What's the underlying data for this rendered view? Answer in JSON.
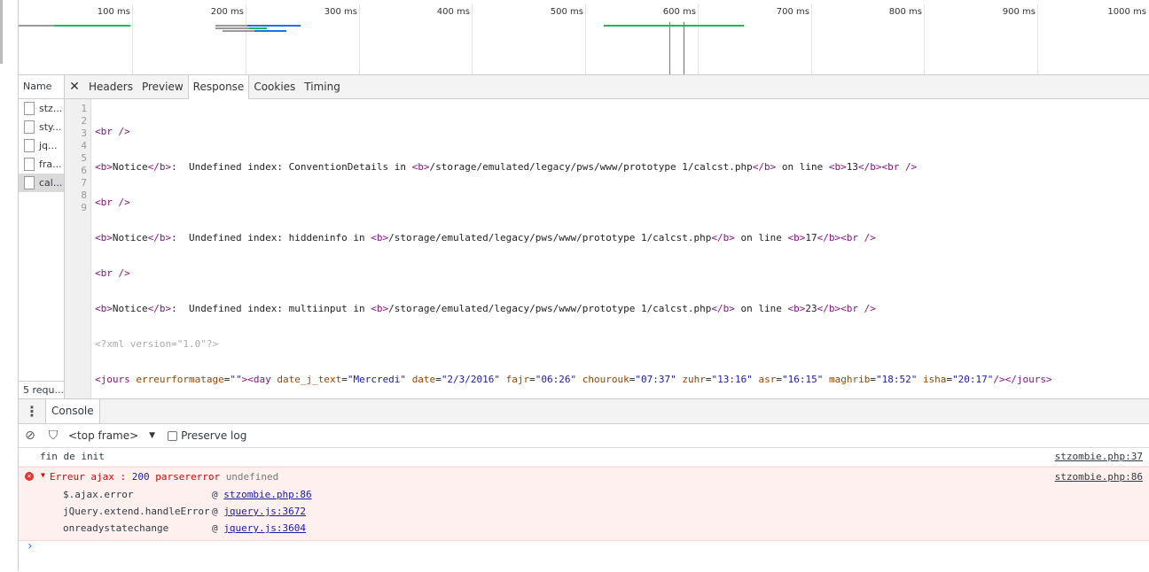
{
  "timeline": {
    "ticks": [
      "100 ms",
      "200 ms",
      "300 ms",
      "400 ms",
      "500 ms",
      "600 ms",
      "700 ms",
      "800 ms",
      "900 ms",
      "1000 ms"
    ]
  },
  "requests": {
    "header": "Name",
    "items": [
      {
        "label": "stz..."
      },
      {
        "label": "sty..."
      },
      {
        "label": "jq..."
      },
      {
        "label": "fra..."
      },
      {
        "label": "cal..."
      }
    ],
    "count": "5 requ..."
  },
  "detail": {
    "tabs": [
      "Headers",
      "Preview",
      "Response",
      "Cookies",
      "Timing"
    ],
    "active_tab": "Response",
    "line_numbers": [
      "1",
      "2",
      "3",
      "4",
      "5",
      "6",
      "7",
      "8",
      "9"
    ],
    "response_lines": [
      "<br />",
      "<b>Notice</b>:  Undefined index: ConventionDetails in <b>/storage/emulated/legacy/pws/www/prototype 1/calcst.php</b> on line <b>13</b><br />",
      "<br />",
      "<b>Notice</b>:  Undefined index: hiddeninfo in <b>/storage/emulated/legacy/pws/www/prototype 1/calcst.php</b> on line <b>17</b><br />",
      "<br />",
      "<b>Notice</b>:  Undefined index: multiinput in <b>/storage/emulated/legacy/pws/www/prototype 1/calcst.php</b> on line <b>23</b><br />",
      "<?xml version=\"1.0\"?>",
      "<jours erreurformatage=\"\"><day date_j_text=\"Mercredi\" date=\"2/3/2016\" fajr=\"06:26\" chourouk=\"07:37\" zuhr=\"13:16\" asr=\"16:15\" maghrib=\"18:52\" isha=\"20:17\"/></jours>",
      ""
    ]
  },
  "console": {
    "tab": "Console",
    "frame": "<top frame>",
    "preserve_log": "Preserve log",
    "log": {
      "text": "fin de init",
      "source": "stzombie.php:37"
    },
    "error": {
      "prefix": "Erreur ajax : ",
      "code": "200",
      "type": " parsererror ",
      "detail": "undefined",
      "source": "stzombie.php:86",
      "stack": [
        {
          "fn": "$.ajax.error",
          "at": "@ ",
          "link": "stzombie.php:86"
        },
        {
          "fn": "jQuery.extend.handleError",
          "at": "@ ",
          "link": "jquery.js:3672"
        },
        {
          "fn": "onreadystatechange",
          "at": "@ ",
          "link": "jquery.js:3604"
        }
      ]
    },
    "prompt": "›"
  },
  "colors": {
    "bar_green": "#1db954",
    "bar_blue": "#1a73e8",
    "error_bg": "#fff0f0"
  }
}
